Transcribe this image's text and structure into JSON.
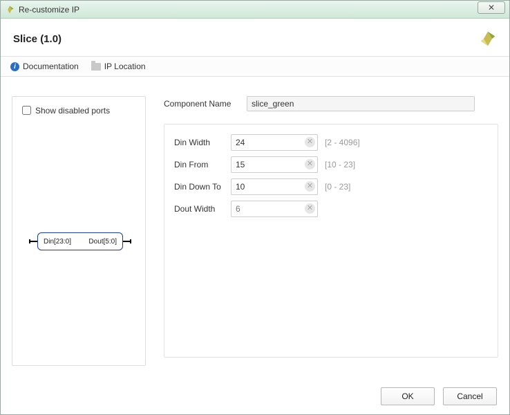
{
  "window": {
    "title": "Re-customize IP"
  },
  "header": {
    "title": "Slice (1.0)"
  },
  "toolbar": {
    "documentation": "Documentation",
    "ip_location": "IP Location"
  },
  "left": {
    "show_disabled_label": "Show disabled ports",
    "block": {
      "din": "Din[23:0]",
      "dout": "Dout[5:0]"
    }
  },
  "right": {
    "component_name_label": "Component Name",
    "component_name_value": "slice_green",
    "params": [
      {
        "label": "Din Width",
        "value": "24",
        "hint": "[2 - 4096]",
        "clearable": true
      },
      {
        "label": "Din From",
        "value": "15",
        "hint": "[10 - 23]",
        "clearable": true
      },
      {
        "label": "Din Down To",
        "value": "10",
        "hint": "[0 - 23]",
        "clearable": true
      },
      {
        "label": "Dout Width",
        "value": "6",
        "hint": "",
        "clearable": true,
        "readonly": true
      }
    ]
  },
  "footer": {
    "ok": "OK",
    "cancel": "Cancel"
  }
}
